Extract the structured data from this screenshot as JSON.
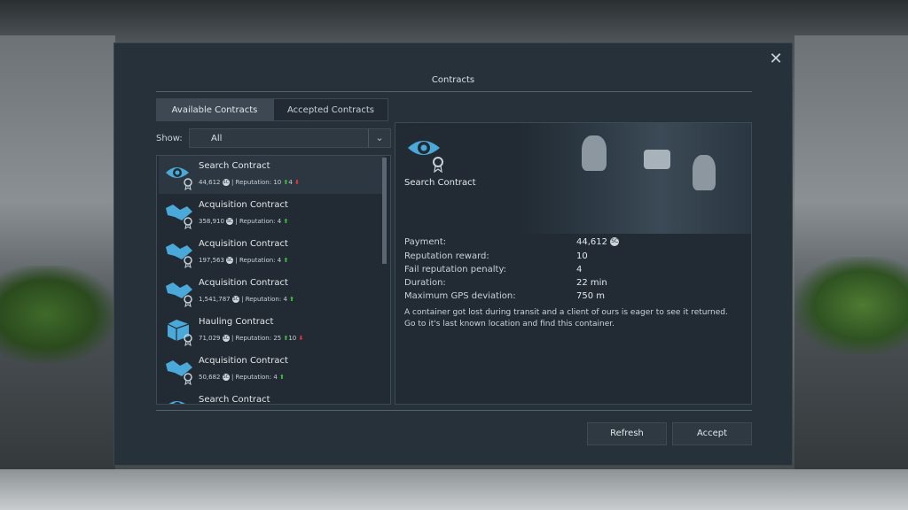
{
  "dialog": {
    "title": "Contracts",
    "close_icon": "close-icon"
  },
  "tabs": [
    {
      "label": "Available Contracts",
      "active": true
    },
    {
      "label": "Accepted Contracts",
      "active": false
    }
  ],
  "filter": {
    "label": "Show:",
    "selected": "All"
  },
  "contracts": [
    {
      "icon": "eye-search-icon",
      "name": "Search Contract",
      "payment": "44,612",
      "reputation_text": "| Reputation: 10",
      "gain": "4",
      "loss": "",
      "selected": true
    },
    {
      "icon": "handshake-icon",
      "name": "Acquisition Contract",
      "payment": "358,910",
      "reputation_text": "| Reputation: 4",
      "gain": "",
      "loss": "",
      "selected": false
    },
    {
      "icon": "handshake-icon",
      "name": "Acquisition Contract",
      "payment": "197,563",
      "reputation_text": "| Reputation: 4",
      "gain": "",
      "loss": "",
      "selected": false
    },
    {
      "icon": "handshake-icon",
      "name": "Acquisition Contract",
      "payment": "1,541,787",
      "reputation_text": "| Reputation: 4",
      "gain": "",
      "loss": "",
      "selected": false
    },
    {
      "icon": "cube-delivery-icon",
      "name": "Hauling Contract",
      "payment": "71,029",
      "reputation_text": "| Reputation: 25",
      "gain": "10",
      "loss": "",
      "selected": false
    },
    {
      "icon": "handshake-icon",
      "name": "Acquisition Contract",
      "payment": "50,682",
      "reputation_text": "| Reputation: 4",
      "gain": "",
      "loss": "",
      "selected": false
    },
    {
      "icon": "eye-search-icon",
      "name": "Search Contract",
      "payment": "",
      "reputation_text": "",
      "gain": "",
      "loss": "",
      "selected": false
    }
  ],
  "details": {
    "name": "Search Contract",
    "rows": [
      {
        "label": "Payment:",
        "value": "44,612"
      },
      {
        "label": "Reputation reward:",
        "value": "10"
      },
      {
        "label": "Fail reputation penalty:",
        "value": "4"
      },
      {
        "label": "Duration:",
        "value": "22 min"
      },
      {
        "label": "Maximum GPS deviation:",
        "value": "750 m"
      }
    ],
    "description": "A container got lost during transit and a client of ours is eager to see it returned. Go to it's last known location and find this container."
  },
  "buttons": {
    "refresh": "Refresh",
    "accept": "Accept"
  },
  "colors": {
    "dialog_bg": "#27313a",
    "panel_bg": "#222b33",
    "accent_icon": "#4aa9d8",
    "reputation_up": "#3fbf3f",
    "reputation_down": "#e03a3a"
  }
}
